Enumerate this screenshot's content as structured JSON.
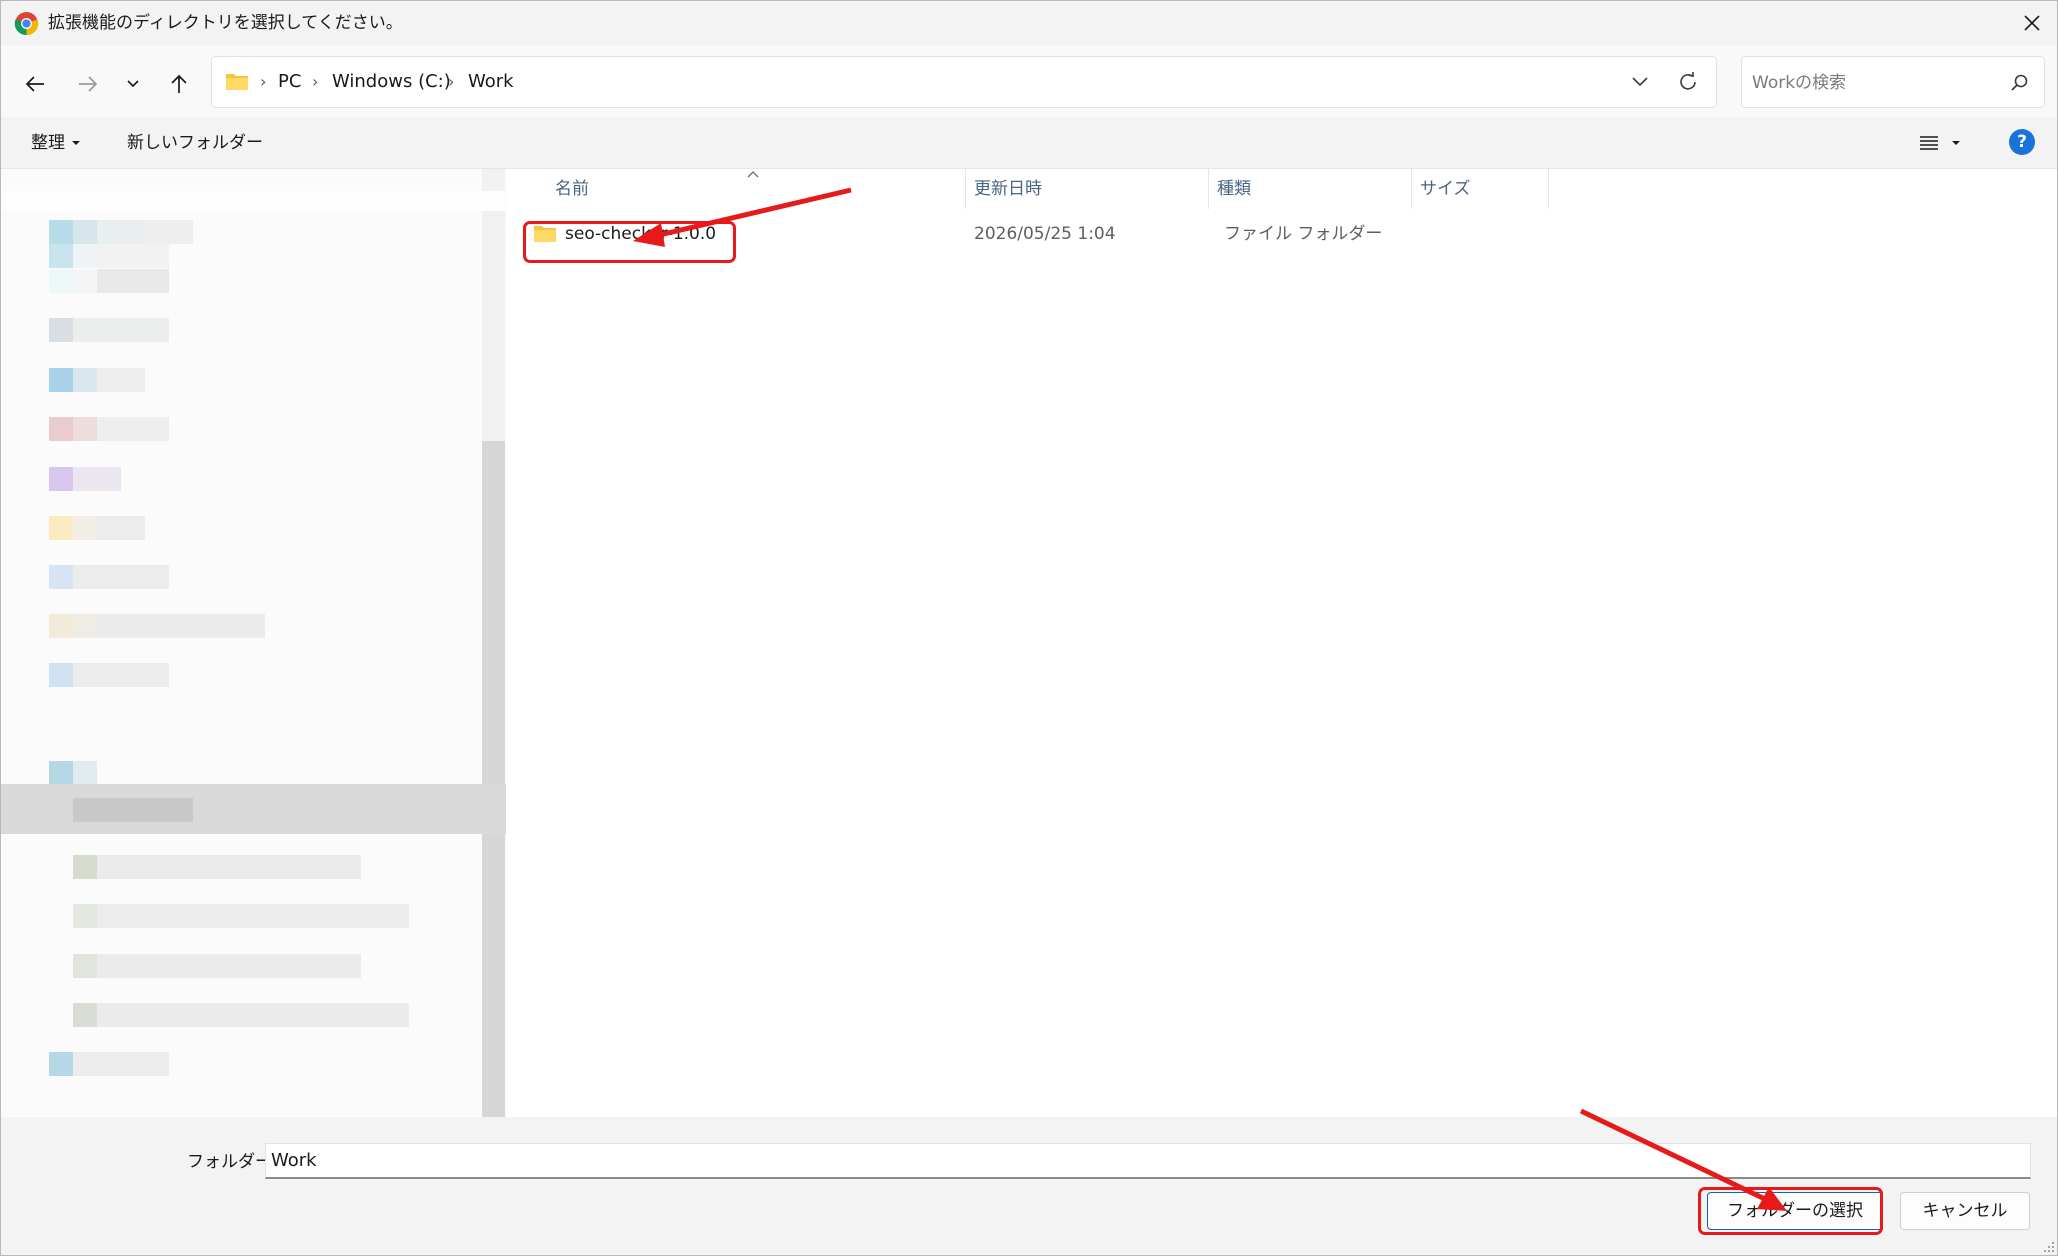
{
  "window": {
    "title": "拡張機能のディレクトリを選択してください。",
    "close_icon": "close-icon",
    "app_icon": "chrome-icon"
  },
  "nav": {
    "back_icon": "arrow-left-icon",
    "forward_icon": "arrow-right-icon",
    "recent_icon": "chevron-down-icon",
    "up_icon": "arrow-up-icon",
    "breadcrumb": [
      "PC",
      "Windows (C:)",
      "Work"
    ],
    "refresh_icon": "refresh-icon"
  },
  "search": {
    "placeholder": "Workの検索",
    "icon": "search-icon"
  },
  "command_bar": {
    "organize": "整理",
    "new_folder": "新しいフォルダー",
    "view_icon": "view-list-icon",
    "help_icon": "help-icon",
    "help_glyph": "?"
  },
  "file_list": {
    "columns": [
      "名前",
      "更新日時",
      "種類",
      "サイズ"
    ],
    "sorted_by": "名前",
    "rows": [
      {
        "name": "seo-checker-1.0.0",
        "modified": "2026/05/25 1:04",
        "type": "ファイル フォルダー",
        "size": ""
      }
    ]
  },
  "footer": {
    "folder_label": "フォルダー:",
    "folder_value": "Work",
    "select_button": "フォルダーの選択",
    "cancel_button": "キャンセル"
  },
  "colors": {
    "accent": "#1a73d9",
    "annotation": "#e8191b",
    "folder_yellow": "#f5c542",
    "header_text": "#4a6484"
  }
}
